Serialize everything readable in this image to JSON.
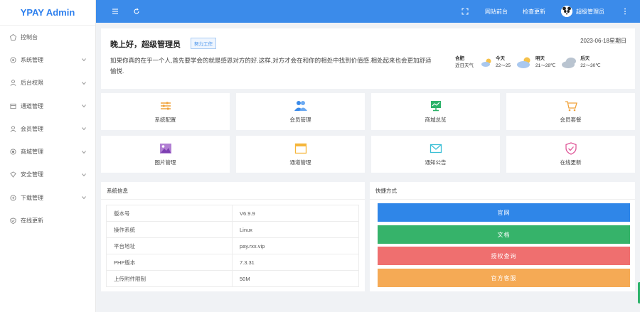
{
  "app": {
    "logo": "YPAY Admin"
  },
  "sidebar": {
    "items": [
      {
        "label": "控制台",
        "icon": "dashboard-icon",
        "has_arrow": false
      },
      {
        "label": "系统管理",
        "icon": "gear-icon",
        "has_arrow": true
      },
      {
        "label": "后台权限",
        "icon": "user-icon",
        "has_arrow": true
      },
      {
        "label": "通道管理",
        "icon": "channel-icon",
        "has_arrow": true
      },
      {
        "label": "会员管理",
        "icon": "member-icon",
        "has_arrow": true
      },
      {
        "label": "商城管理",
        "icon": "shop-icon",
        "has_arrow": true
      },
      {
        "label": "安全管理",
        "icon": "security-icon",
        "has_arrow": true
      },
      {
        "label": "下载管理",
        "icon": "download-icon",
        "has_arrow": true
      },
      {
        "label": "在线更新",
        "icon": "update-icon",
        "has_arrow": false
      }
    ]
  },
  "header": {
    "links": [
      "网站前台",
      "检查更新"
    ],
    "username": "超级管理员"
  },
  "welcome": {
    "title": "晚上好，超级管理员",
    "badge": "努力工作",
    "date": "2023-06-18星期日",
    "message": "如果你真的在乎一个人,首先要学会的就是感恩对方的好.这样,对方才会在和你的相处中找到价值感.相处起来也会更加舒适愉悦."
  },
  "weather": {
    "city": "合肥",
    "city_sub": "近日天气",
    "days": [
      {
        "day": "今天",
        "temp": "22～25"
      },
      {
        "day": "明天",
        "temp": "21～28℃"
      },
      {
        "day": "后天",
        "temp": "22～30℃"
      }
    ]
  },
  "tiles": [
    {
      "label": "系统配置",
      "icon": "sliders-icon",
      "color": "#f0a23a"
    },
    {
      "label": "会员管理",
      "icon": "users-icon",
      "color": "#3b8bea"
    },
    {
      "label": "商城总览",
      "icon": "store-overview-icon",
      "color": "#2db36a"
    },
    {
      "label": "会员套餐",
      "icon": "cart-icon",
      "color": "#f0a23a"
    },
    {
      "label": "图片管理",
      "icon": "image-icon",
      "color": "#9b59b6"
    },
    {
      "label": "通道管理",
      "icon": "window-icon",
      "color": "#f5b63b"
    },
    {
      "label": "通知公告",
      "icon": "mail-icon",
      "color": "#3bbfd6"
    },
    {
      "label": "在线更新",
      "icon": "shield-check-icon",
      "color": "#e05a9b"
    }
  ],
  "sysinfo": {
    "title": "系统信息",
    "rows": [
      {
        "key": "版本号",
        "value": "V6.9.9"
      },
      {
        "key": "操作系统",
        "value": "Linux"
      },
      {
        "key": "平台地址",
        "value": "pay.rxx.vip"
      },
      {
        "key": "PHP版本",
        "value": "7.3.31"
      },
      {
        "key": "上传附件限制",
        "value": "50M"
      }
    ]
  },
  "shortcuts": {
    "title": "快捷方式",
    "buttons": [
      {
        "label": "官网",
        "color": "#2f86e8"
      },
      {
        "label": "文档",
        "color": "#36b36a"
      },
      {
        "label": "授权查询",
        "color": "#ef6f6f"
      },
      {
        "label": "官方客服",
        "color": "#f5aa55"
      }
    ]
  },
  "colors": {
    "primary": "#3b8bea",
    "sidebar_bg": "#ffffff",
    "page_bg": "#f0f2f5"
  }
}
